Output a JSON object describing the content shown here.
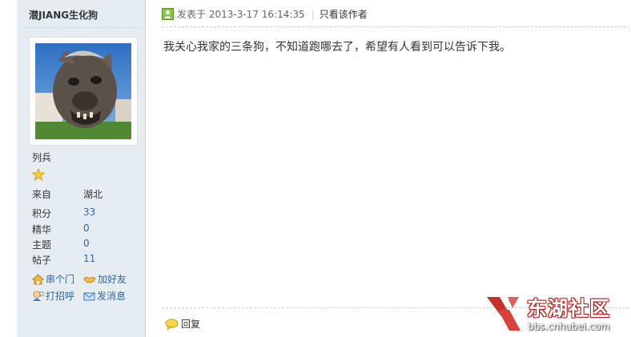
{
  "author": {
    "name": "潜JIANG生化狗",
    "group": "列兵",
    "location_label": "来自",
    "location_value": "湖北",
    "stats": [
      {
        "label": "积分",
        "value": "33"
      },
      {
        "label": "精华",
        "value": "0"
      },
      {
        "label": "主题",
        "value": "0"
      },
      {
        "label": "帖子",
        "value": "11"
      }
    ],
    "actions": {
      "visit": "串个门",
      "add_friend": "加好友",
      "greet": "打招呼",
      "message": "发消息"
    }
  },
  "post": {
    "posted_prefix": "发表于",
    "timestamp": "2013-3-17 16:14:35",
    "only_author": "只看该作者",
    "content": "我关心我家的三条狗，不知道跑哪去了，希望有人看到可以告诉下我。",
    "reply_label": "回复"
  },
  "watermark": {
    "brand": "东湖社区",
    "url": "bbs.cnhubei.com"
  },
  "colors": {
    "sidebar_bg": "#e5edf2",
    "link": "#336699",
    "brand_red": "#b4201d"
  }
}
